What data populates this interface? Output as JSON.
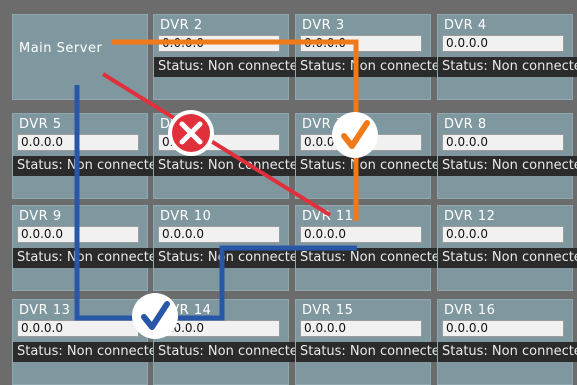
{
  "grid": {
    "server": {
      "label": "Main Server"
    },
    "cells": [
      {
        "label": "DVR 2",
        "ip": "0.0.0.0",
        "status": "Status: Non connected"
      },
      {
        "label": "DVR 3",
        "ip": "0.0.0.0",
        "status": "Status: Non connected"
      },
      {
        "label": "DVR 4",
        "ip": "0.0.0.0",
        "status": "Status: Non connected"
      },
      {
        "label": "DVR 5",
        "ip": "0.0.0.0",
        "status": "Status: Non connected"
      },
      {
        "label": "DVR 6",
        "ip": "0.0.0.0",
        "status": "Status: Non connected"
      },
      {
        "label": "DVR 7",
        "ip": "0.0.0.0",
        "status": "Status: Non connected"
      },
      {
        "label": "DVR 8",
        "ip": "0.0.0.0",
        "status": "Status: Non connected"
      },
      {
        "label": "DVR 9",
        "ip": "0.0.0.0",
        "status": "Status: Non connected"
      },
      {
        "label": "DVR 10",
        "ip": "0.0.0.0",
        "status": "Status: Non connected"
      },
      {
        "label": "DVR 11",
        "ip": "0.0.0.0",
        "status": "Status: Non connected"
      },
      {
        "label": "DVR 12",
        "ip": "0.0.0.0",
        "status": "Status: Non connected"
      },
      {
        "label": "DVR 13",
        "ip": "0.0.0.0",
        "status": "Status: Non connected"
      },
      {
        "label": "DVR 14",
        "ip": "0.0.0.0",
        "status": "Status: Non connected"
      },
      {
        "label": "DVR 15",
        "ip": "0.0.0.0",
        "status": "Status: Non connected"
      },
      {
        "label": "DVR 16",
        "ip": "0.0.0.0",
        "status": "Status: Non connected"
      }
    ]
  },
  "annotations": {
    "orange_path_color": "#f07a1a",
    "blue_path_color": "#2857a8",
    "red_line_color": "#e0303c",
    "cross_icon": "cross-circle-icon",
    "check_icon": "check-circle-icon"
  }
}
